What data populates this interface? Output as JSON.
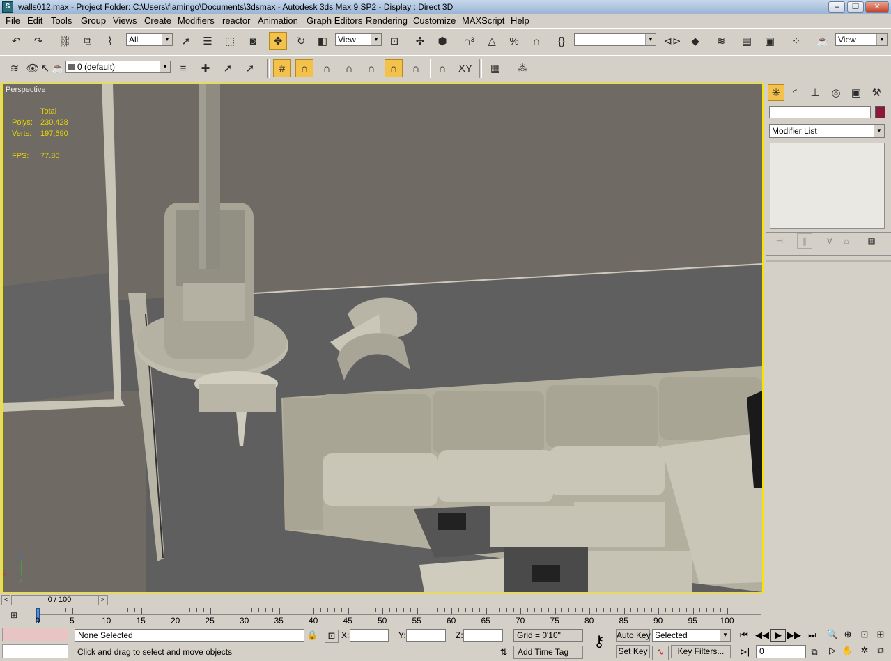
{
  "window": {
    "title": "walls012.max    - Project Folder: C:\\Users\\flamingo\\Documents\\3dsmax    - Autodesk 3ds Max 9 SP2    - Display : Direct 3D",
    "minimize": "‒",
    "maximize": "❐",
    "close": "✕"
  },
  "menu": [
    "File",
    "Edit",
    "Tools",
    "Group",
    "Views",
    "Create",
    "Modifiers",
    "reactor",
    "Animation",
    "Graph Editors",
    "Rendering",
    "Customize",
    "MAXScript",
    "Help"
  ],
  "toolbar": {
    "selection_filter": "All",
    "ref_coord": "View",
    "named_selection": "",
    "render_view": "View",
    "layer": "0 (default)"
  },
  "viewport": {
    "label": "Perspective",
    "stats_header": "Total",
    "polys_label": "Polys:",
    "polys_value": "230,428",
    "verts_label": "Verts:",
    "verts_value": "197,590",
    "fps_label": "FPS:",
    "fps_value": "77.80",
    "axis_z": "z",
    "axis_x": "x",
    "axis_y": "y"
  },
  "command_panel": {
    "modifier_list": "Modifier List",
    "name_value": "",
    "object_color": "#8b1a3a"
  },
  "timeline": {
    "slider_label": "0 / 100",
    "ticks": [
      "0",
      "5",
      "10",
      "15",
      "20",
      "25",
      "30",
      "35",
      "40",
      "45",
      "50",
      "55",
      "60",
      "65",
      "70",
      "75",
      "80",
      "85",
      "90",
      "95",
      "100"
    ]
  },
  "status": {
    "selection": "None Selected",
    "prompt": "Click and drag to select and move objects",
    "x_label": "X:",
    "y_label": "Y:",
    "z_label": "Z:",
    "grid": "Grid = 0'10\"",
    "add_time_tag": "Add Time Tag",
    "auto_key": "Auto Key",
    "set_key": "Set Key",
    "key_mode": "Selected",
    "key_filters": "Key Filters...",
    "frame": "0"
  }
}
